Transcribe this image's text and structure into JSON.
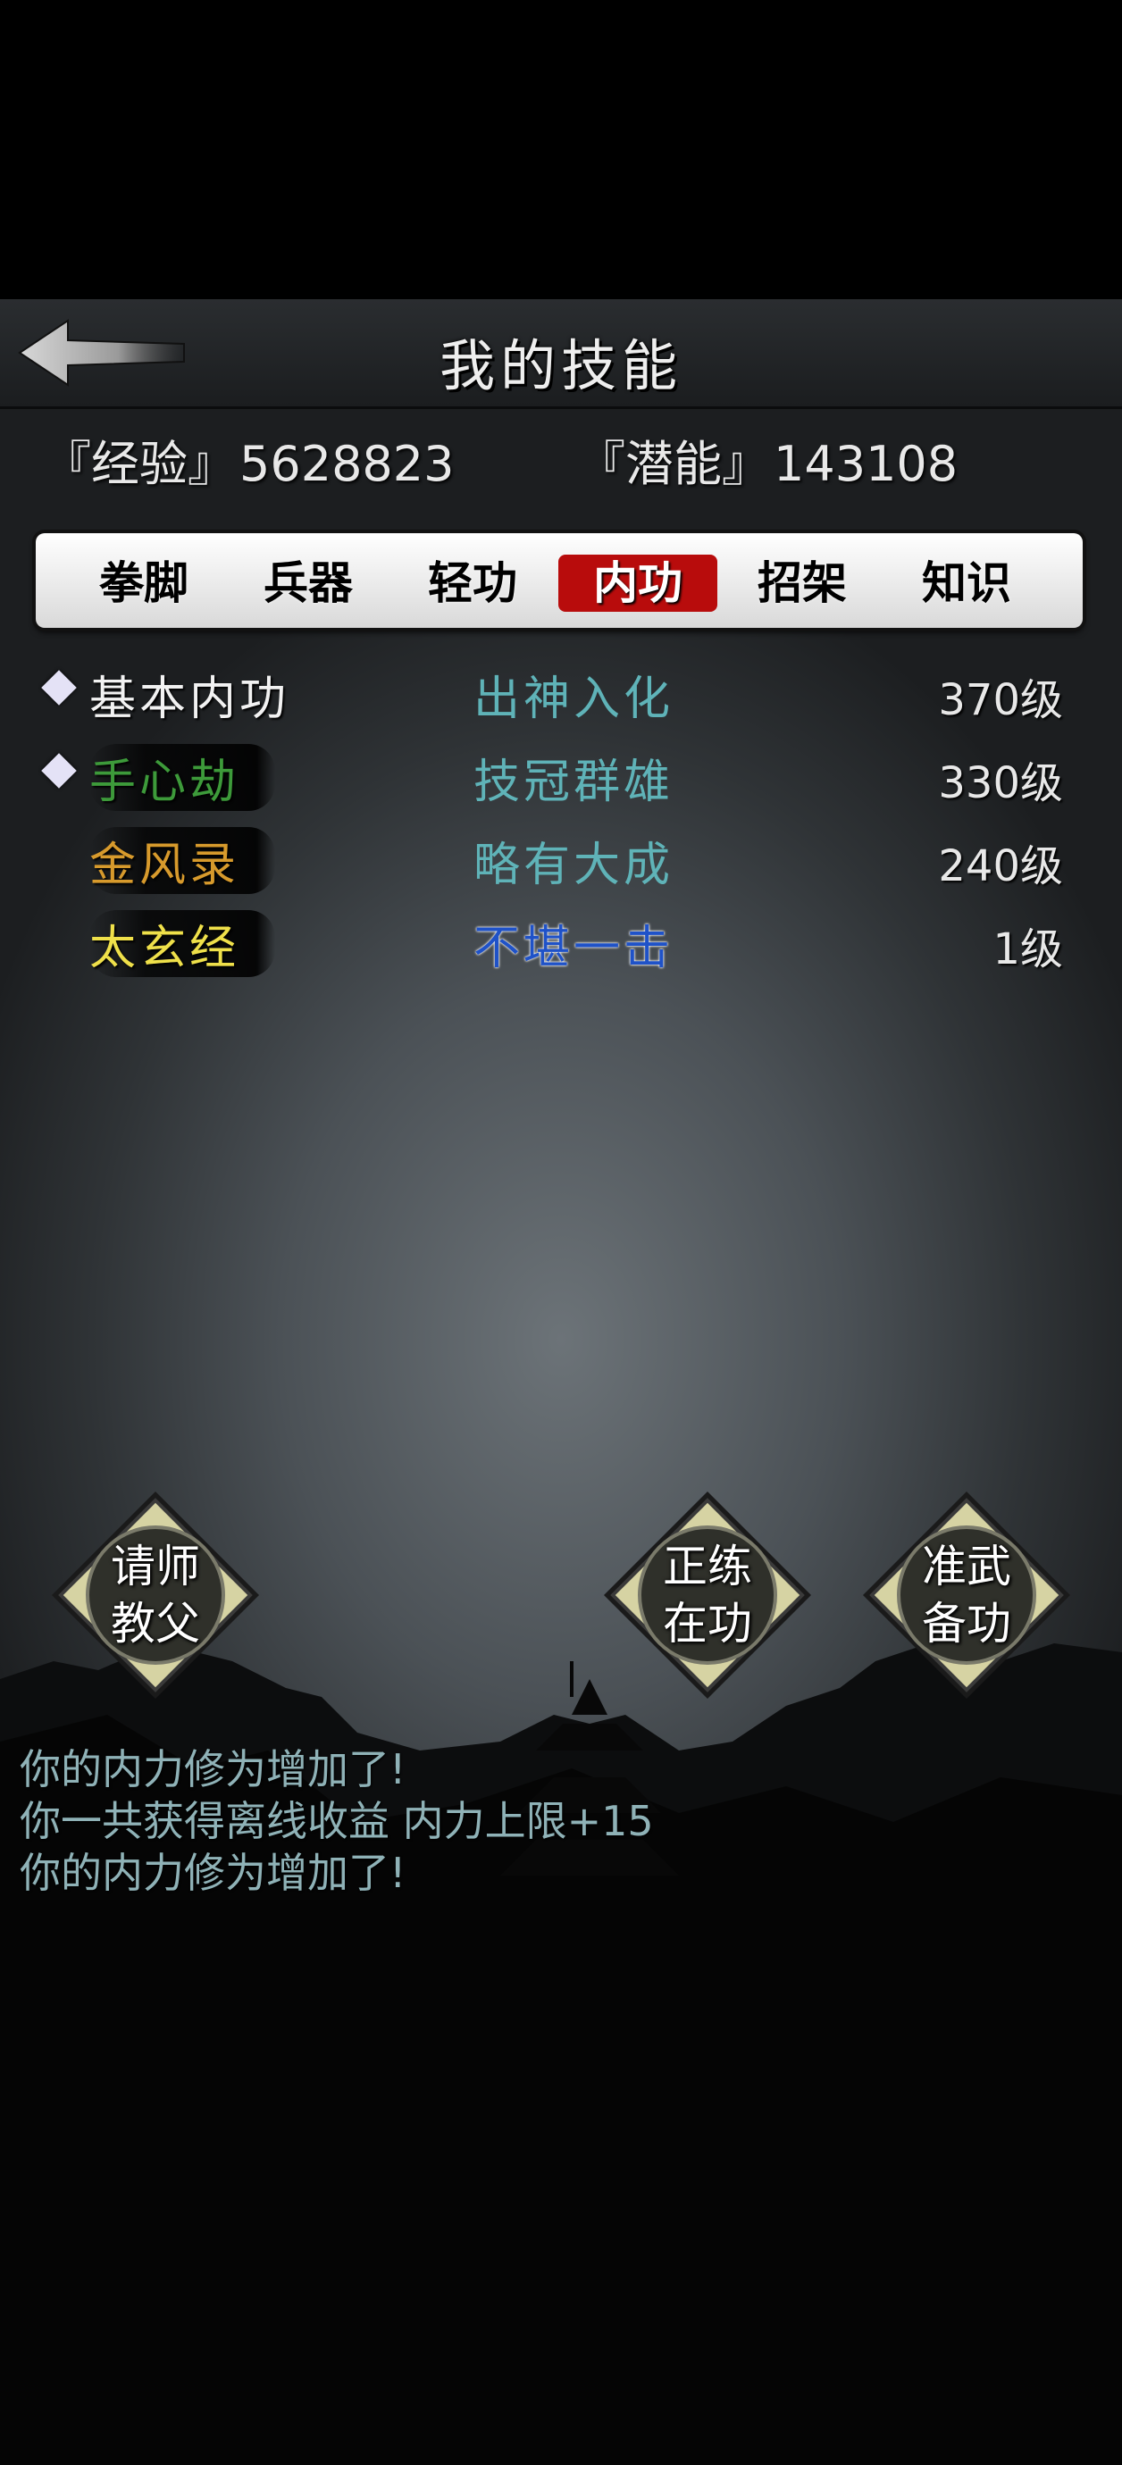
{
  "header": {
    "title": "我的技能",
    "back_icon": "back-arrow-icon"
  },
  "stats": {
    "experience_label": "『经验』",
    "experience_value": "5628823",
    "potential_label": "『潜能』",
    "potential_value": "143108"
  },
  "tabs": [
    {
      "label": "拳脚",
      "active": false
    },
    {
      "label": "兵器",
      "active": false
    },
    {
      "label": "轻功",
      "active": false
    },
    {
      "label": "内功",
      "active": true
    },
    {
      "label": "招架",
      "active": false
    },
    {
      "label": "知识",
      "active": false
    }
  ],
  "skills": [
    {
      "name": "基本内功",
      "level_title": "出神入化",
      "level": "370级",
      "name_color": "#f2f2f2",
      "title_color": "#5fb3b8",
      "marked": true
    },
    {
      "name": "手心劫",
      "level_title": "技冠群雄",
      "level": "330级",
      "name_color": "#3d9a3a",
      "title_color": "#5fb3b8",
      "marked": true
    },
    {
      "name": "金风录",
      "level_title": "略有大成",
      "level": "240级",
      "name_color": "#d79a2c",
      "title_color": "#5fb3b8",
      "marked": false
    },
    {
      "name": "太玄经",
      "level_title": "不堪一击",
      "level": "1级",
      "name_color": "#efe04a",
      "title_color": "#1f52c8",
      "marked": false
    }
  ],
  "actions": {
    "ask_master": [
      "请师",
      "教父"
    ],
    "practice": [
      "正练",
      "在功"
    ],
    "prepare": [
      "准武",
      "备功"
    ]
  },
  "log": [
    "你的内力修为增加了!",
    "你一共获得离线收益 内力上限+15",
    "你的内力修为增加了!"
  ]
}
